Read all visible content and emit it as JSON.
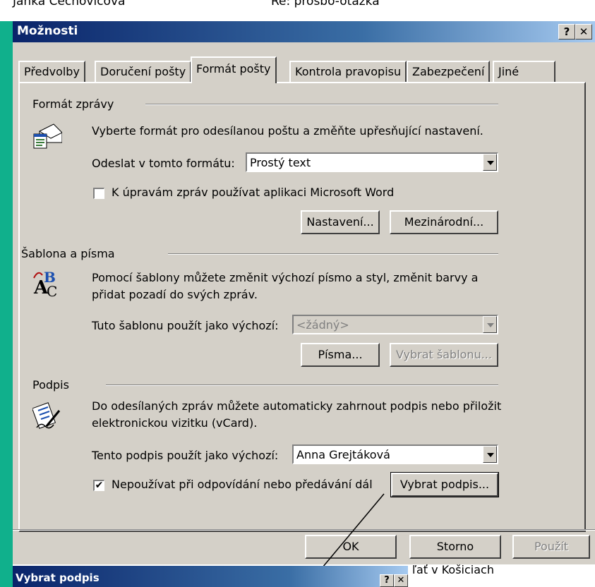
{
  "background": {
    "sender": "Janka Čechovičová",
    "subject": "Re: prosbo-otázka",
    "snippet": "ľať v Košiciach"
  },
  "dialog": {
    "title": "Možnosti",
    "help_label": "?",
    "close_label": "✕",
    "tabs": [
      "Předvolby",
      "Doručení pošty",
      "Formát pošty",
      "Kontrola pravopisu",
      "Zabezpečení",
      "Jiné"
    ],
    "active_tab": "Formát pošty",
    "format": {
      "group": "Formát zprávy",
      "description": "Vyberte formát pro odesílanou poštu a změňte upřesňující nastavení.",
      "send_label": "Odeslat v tomto formátu:",
      "send_value": "Prostý text",
      "word_label": "K úpravám zpráv používat aplikaci Microsoft Word",
      "settings_button": "Nastavení...",
      "international_button": "Mezinárodní..."
    },
    "stationery": {
      "group": "Šablona a písma",
      "description_1": "Pomocí šablony můžete změnit výchozí písmo a styl, změnit barvy a",
      "description_2": "přidat pozadí do svých zpráv.",
      "default_label": "Tuto šablonu použít jako výchozí:",
      "default_value": "<žádný>",
      "fonts_button": "Písma...",
      "select_button": "Vybrat šablonu..."
    },
    "signature": {
      "group": "Podpis",
      "description_1": "Do odesílaných zpráv můžete automaticky zahrnout podpis nebo přiložit",
      "description_2": "elektronickou vizitku (vCard).",
      "default_label": "Tento podpis použít jako výchozí:",
      "default_value": "Anna Grejtáková",
      "no_reply_label": "Nepoužívat při odpovídání nebo předávání dál",
      "select_button": "Vybrat podpis..."
    },
    "buttons": {
      "ok": "OK",
      "cancel": "Storno",
      "apply": "Použít"
    }
  },
  "subdialog": {
    "title": "Vybrat podpis"
  }
}
